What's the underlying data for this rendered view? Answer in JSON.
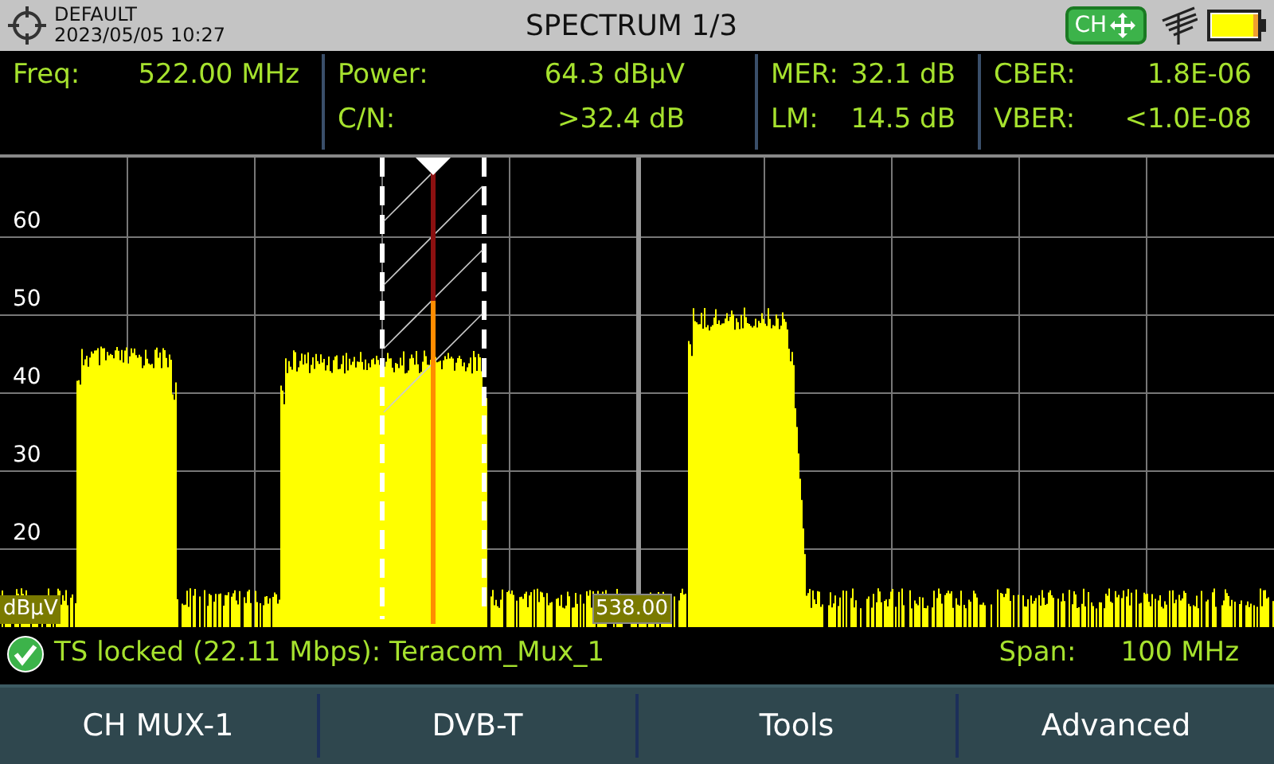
{
  "header": {
    "preset": "DEFAULT",
    "datetime": "2023/05/05 10:27",
    "title": "SPECTRUM 1/3",
    "mode_badge": "CH"
  },
  "measurements": [
    [
      {
        "label": "Freq:",
        "value": "522.00 MHz"
      }
    ],
    [
      {
        "label": "Power:",
        "value": "64.3 dBµV"
      },
      {
        "label": "C/N:",
        "value": ">32.4 dB"
      }
    ],
    [
      {
        "label": "MER:",
        "value": "32.1 dB"
      },
      {
        "label": "LM:",
        "value": "14.5 dB"
      }
    ],
    [
      {
        "label": "CBER:",
        "value": "1.8E-06"
      },
      {
        "label": "VBER:",
        "value": "<1.0E-08"
      }
    ]
  ],
  "chart": {
    "y_labels": [
      "60",
      "50",
      "40",
      "30",
      "20"
    ],
    "unit": "dBµV",
    "center_freq": "538.00"
  },
  "status": {
    "locked": true,
    "text": "TS locked (22.11 Mbps): Teracom_Mux_1",
    "span_label": "Span:",
    "span_value": "100 MHz"
  },
  "softkeys": [
    "CH MUX-1",
    "DVB-T",
    "Tools",
    "Advanced"
  ]
}
